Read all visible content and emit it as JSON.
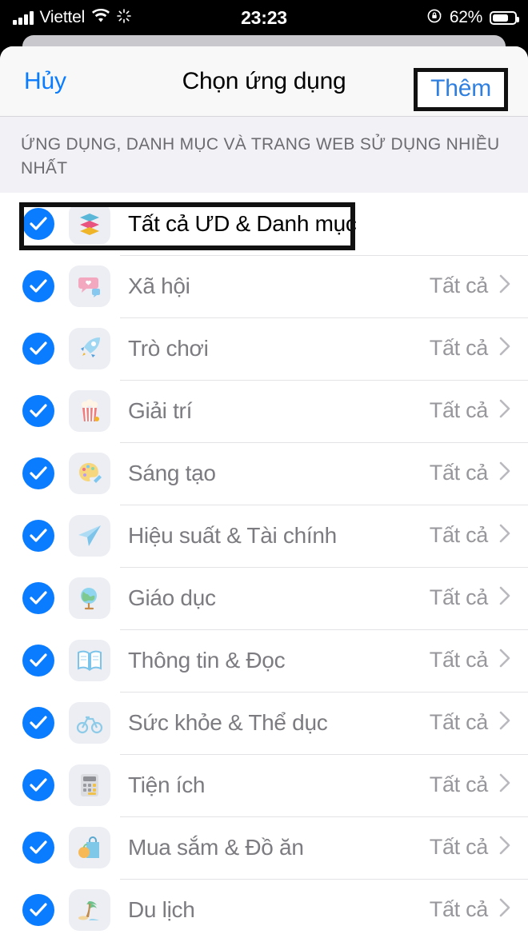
{
  "status_bar": {
    "carrier": "Viettel",
    "time": "23:23",
    "battery_percent": "62%",
    "signal_icon": "signal-bars-icon",
    "wifi_icon": "wifi-icon",
    "activity_icon": "activity-spinner-icon",
    "rotation_lock_icon": "rotation-lock-icon",
    "battery_icon": "battery-icon"
  },
  "nav": {
    "cancel_label": "Hủy",
    "title": "Chọn ứng dụng",
    "add_label": "Thêm"
  },
  "section": {
    "header": "ỨNG DỤNG, DANH MỤC VÀ TRANG WEB SỬ DỤNG NHIỀU NHẤT"
  },
  "colors": {
    "accent_blue": "#0a7cff",
    "link_blue": "#2f7fe0",
    "label_gray": "#7b7b80",
    "value_gray": "#97979c",
    "annotation_black": "#111111"
  },
  "rows": [
    {
      "label": "Tất cả ƯD & Danh mục",
      "value": "",
      "icon": "layers-icon",
      "checked": true,
      "selected": true,
      "annotated": true,
      "has_chevron": false
    },
    {
      "label": "Xã hội",
      "value": "Tất cả",
      "icon": "chat-heart-icon",
      "checked": true,
      "selected": false,
      "annotated": false,
      "has_chevron": true
    },
    {
      "label": "Trò chơi",
      "value": "Tất cả",
      "icon": "rocket-icon",
      "checked": true,
      "selected": false,
      "annotated": false,
      "has_chevron": true
    },
    {
      "label": "Giải trí",
      "value": "Tất cả",
      "icon": "popcorn-icon",
      "checked": true,
      "selected": false,
      "annotated": false,
      "has_chevron": true
    },
    {
      "label": "Sáng tạo",
      "value": "Tất cả",
      "icon": "paint-palette-icon",
      "checked": true,
      "selected": false,
      "annotated": false,
      "has_chevron": true
    },
    {
      "label": "Hiệu suất & Tài chính",
      "value": "Tất cả",
      "icon": "paper-plane-icon",
      "checked": true,
      "selected": false,
      "annotated": false,
      "has_chevron": true
    },
    {
      "label": "Giáo dục",
      "value": "Tất cả",
      "icon": "globe-icon",
      "checked": true,
      "selected": false,
      "annotated": false,
      "has_chevron": true
    },
    {
      "label": "Thông tin & Đọc",
      "value": "Tất cả",
      "icon": "open-book-icon",
      "checked": true,
      "selected": false,
      "annotated": false,
      "has_chevron": true
    },
    {
      "label": "Sức khỏe & Thể dục",
      "value": "Tất cả",
      "icon": "bicycle-icon",
      "checked": true,
      "selected": false,
      "annotated": false,
      "has_chevron": true
    },
    {
      "label": "Tiện ích",
      "value": "Tất cả",
      "icon": "calculator-icon",
      "checked": true,
      "selected": false,
      "annotated": false,
      "has_chevron": true
    },
    {
      "label": "Mua sắm & Đồ ăn",
      "value": "Tất cả",
      "icon": "shopping-bag-icon",
      "checked": true,
      "selected": false,
      "annotated": false,
      "has_chevron": true
    },
    {
      "label": "Du lịch",
      "value": "Tất cả",
      "icon": "palm-beach-icon",
      "checked": true,
      "selected": false,
      "annotated": false,
      "has_chevron": true
    }
  ]
}
